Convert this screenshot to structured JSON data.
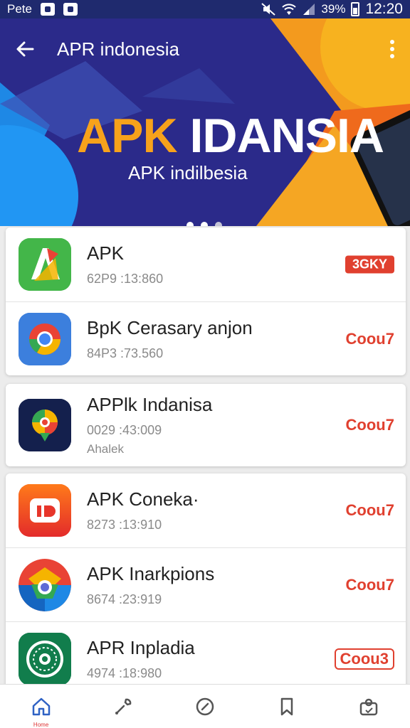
{
  "status_bar": {
    "left_text": "Pete",
    "battery": "39%",
    "time": "12:20"
  },
  "app_bar": {
    "title": "APR indonesia",
    "back_icon": "arrow-left-icon",
    "refresh_icon": "refresh-icon",
    "menu_icon": "more-vertical-icon"
  },
  "banner": {
    "title_accent": "APK",
    "title_main": " IDANSIA",
    "subtitle": "APK indilbesia",
    "slide_count": 3,
    "active_slide": 2
  },
  "app_groups": [
    [
      {
        "name": "APK",
        "meta": "62P9 :13:860",
        "action": "3GKY",
        "action_style": "filled",
        "icon": "android-app-icon"
      },
      {
        "name": "BpK Cerasary anjon",
        "meta": "84P3 :73.560",
        "action": "Coou7",
        "action_style": "text",
        "icon": "chrome-icon"
      }
    ],
    [
      {
        "name": "APPlk Indanisa",
        "meta": "0029 :43:009",
        "extra": "Ahalek",
        "action": "Coou7",
        "action_style": "text",
        "icon": "colorful-pin-icon"
      }
    ],
    [
      {
        "name": "APK Coneka·",
        "meta": "8273 :13:910",
        "action": "Coou7",
        "action_style": "text",
        "icon": "video-app-icon"
      },
      {
        "name": "APK Inarkpions",
        "meta": "8674 :23:919",
        "action": "Coou7",
        "action_style": "text",
        "icon": "google-drive-icon"
      },
      {
        "name": "APR Inpladia",
        "meta": "4974 :18:980",
        "action": "Coou3",
        "action_style": "outline",
        "icon": "emblem-icon"
      }
    ]
  ],
  "bottom_nav": [
    {
      "name": "home",
      "icon": "home-icon",
      "label": "Home",
      "active": true
    },
    {
      "name": "tools",
      "icon": "wrench-icon",
      "label": "",
      "active": false
    },
    {
      "name": "explore",
      "icon": "compass-icon",
      "label": "",
      "active": false
    },
    {
      "name": "saved",
      "icon": "bookmark-icon",
      "label": "",
      "active": false
    },
    {
      "name": "account",
      "icon": "user-icon",
      "label": "",
      "active": false
    }
  ],
  "colors": {
    "primary_blue": "#2b2a8a",
    "accent_orange": "#f7a21b",
    "action_red": "#e0402f",
    "nav_active": "#2f62c4"
  }
}
